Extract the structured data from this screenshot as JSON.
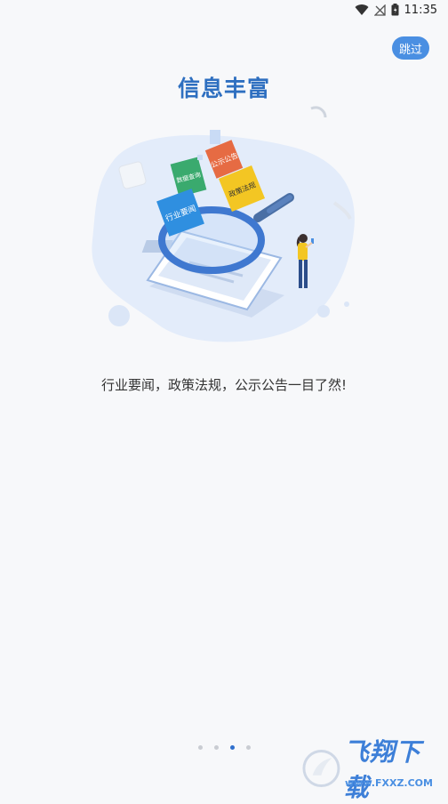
{
  "status": {
    "time": "11:35"
  },
  "header": {
    "skip_label": "跳过"
  },
  "page": {
    "title": "信息丰富",
    "description": "行业要闻，政策法规，公示公告一目了然!"
  },
  "illustration": {
    "tags": {
      "industry_news": "行业要闻",
      "data_query": "数据查询",
      "public_notice": "公示公告",
      "policy_law": "政策法规"
    }
  },
  "pager": {
    "count": 4,
    "active_index": 2
  },
  "watermark": {
    "text": "飞翔下载",
    "url": "www.FXXZ.COM"
  },
  "colors": {
    "accent": "#4a8fe2",
    "title": "#2e6fc0",
    "blob": "#e3ecfa"
  }
}
